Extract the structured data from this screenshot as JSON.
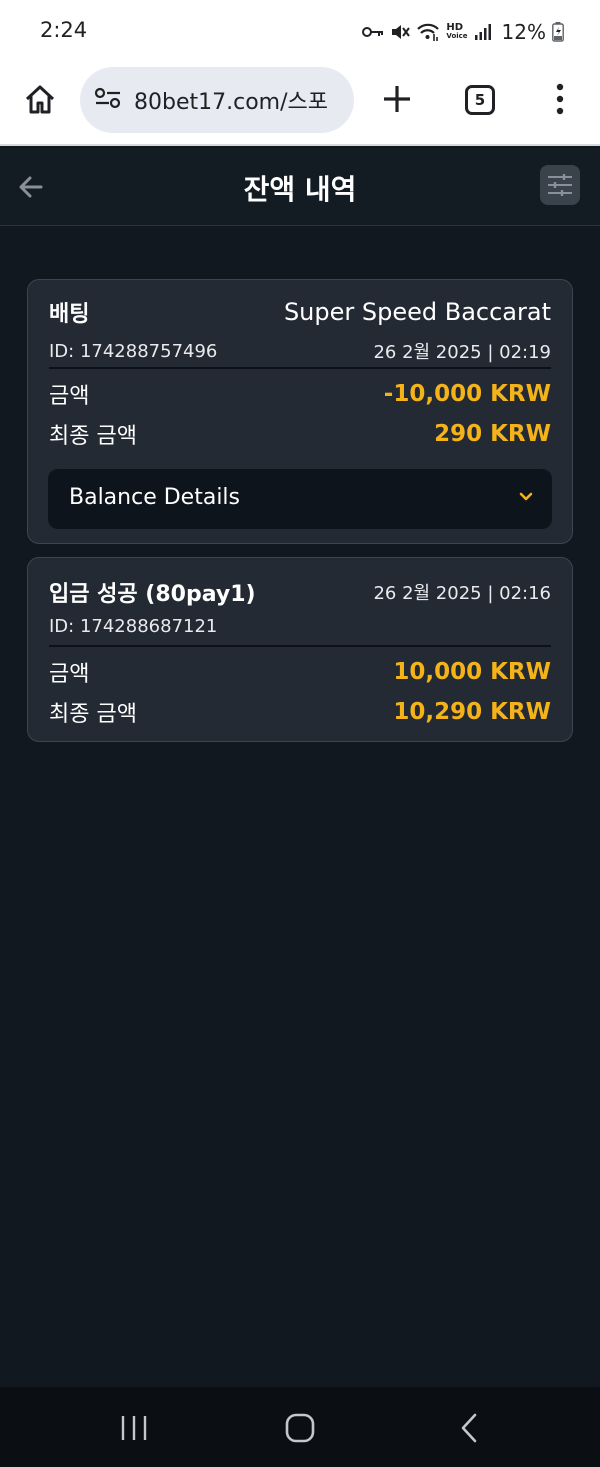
{
  "status_bar": {
    "time": "2:24",
    "hd_label": "HD",
    "voice_label": "Voice",
    "battery": "12%"
  },
  "browser": {
    "url": "80bet17.com/스포",
    "tab_count": "5"
  },
  "header": {
    "title": "잔액 내역"
  },
  "transactions": [
    {
      "type": "배팅",
      "game": "Super Speed Baccarat",
      "id": "ID: 174288757496",
      "date": "26 2월 2025 | 02:19",
      "amount_label": "금액",
      "amount": "-10,000 KRW",
      "final_label": "최종 금액",
      "final_amount": "290 KRW",
      "details_label": "Balance Details"
    },
    {
      "type": "입금 성공 (80pay1)",
      "id": "ID: 174288687121",
      "date": "26 2월 2025 | 02:16",
      "amount_label": "금액",
      "amount": "10,000 KRW",
      "final_label": "최종 금액",
      "final_amount": "10,290 KRW"
    }
  ],
  "colors": {
    "page_bg": "#111820",
    "card_bg": "#232a33",
    "amount": "#f5b31a"
  }
}
